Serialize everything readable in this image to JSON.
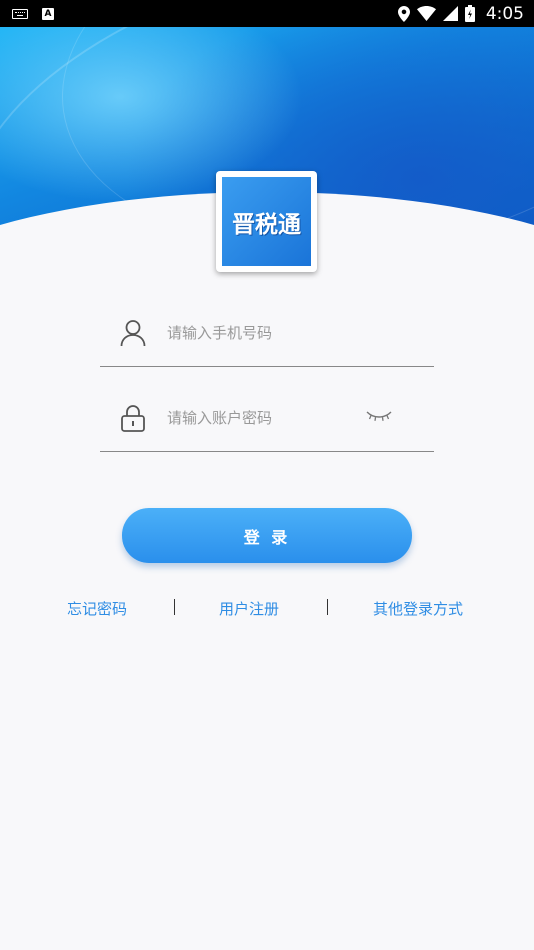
{
  "status_bar": {
    "time": "4:05",
    "icons": [
      "keyboard-icon",
      "a-notification-icon",
      "location-icon",
      "wifi-icon",
      "signal-icon",
      "battery-icon"
    ],
    "badge_letter": "A"
  },
  "header": {
    "colors": {
      "top": "#1fb4f5",
      "mid": "#1286e0",
      "bottom": "#0a5dc4"
    }
  },
  "logo": {
    "text": "晋税通",
    "color": "#2a86e4"
  },
  "form": {
    "phone": {
      "placeholder": "请输入手机号码",
      "value": "",
      "icon": "user-icon"
    },
    "password": {
      "placeholder": "请输入账户密码",
      "value": "",
      "icon": "lock-icon",
      "toggle_icon": "eye-closed-icon"
    }
  },
  "login_button": {
    "label": "登 录",
    "color": "#2a8fec"
  },
  "links": {
    "forgot": "忘记密码",
    "register": "用户注册",
    "other": "其他登录方式",
    "color": "#2f8de4"
  }
}
